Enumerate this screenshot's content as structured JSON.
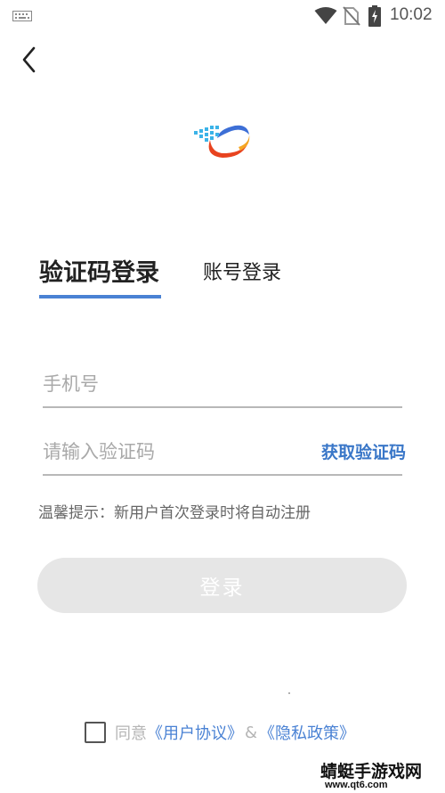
{
  "status_bar": {
    "time": "10:02",
    "icons": [
      "keyboard-icon",
      "wifi-icon",
      "no-sim-icon",
      "battery-charging-icon"
    ]
  },
  "header": {
    "back_icon": "chevron-left-icon"
  },
  "logo": {
    "icon": "app-logo-icon",
    "colors": [
      "#3d6fd6",
      "#e8431f",
      "#f5a623",
      "#3bb3e8"
    ]
  },
  "tabs": [
    {
      "label": "验证码登录",
      "active": true
    },
    {
      "label": "账号登录",
      "active": false
    }
  ],
  "form": {
    "phone_placeholder": "手机号",
    "code_placeholder": "请输入验证码",
    "get_code_label": "获取验证码",
    "tip": "温馨提示：新用户首次登录时将自动注册",
    "login_label": "登录"
  },
  "agreement": {
    "prefix": "同意",
    "user_agreement": "《用户协议》",
    "amp": "&",
    "privacy_policy": "《隐私政策》",
    "checked": false
  },
  "watermark": {
    "title": "蜻蜓手游戏网",
    "url": "www.qt6.com"
  },
  "colors": {
    "accent": "#4a82d4",
    "button_disabled": "#e6e6e6",
    "text_muted": "#a9a9a9"
  }
}
